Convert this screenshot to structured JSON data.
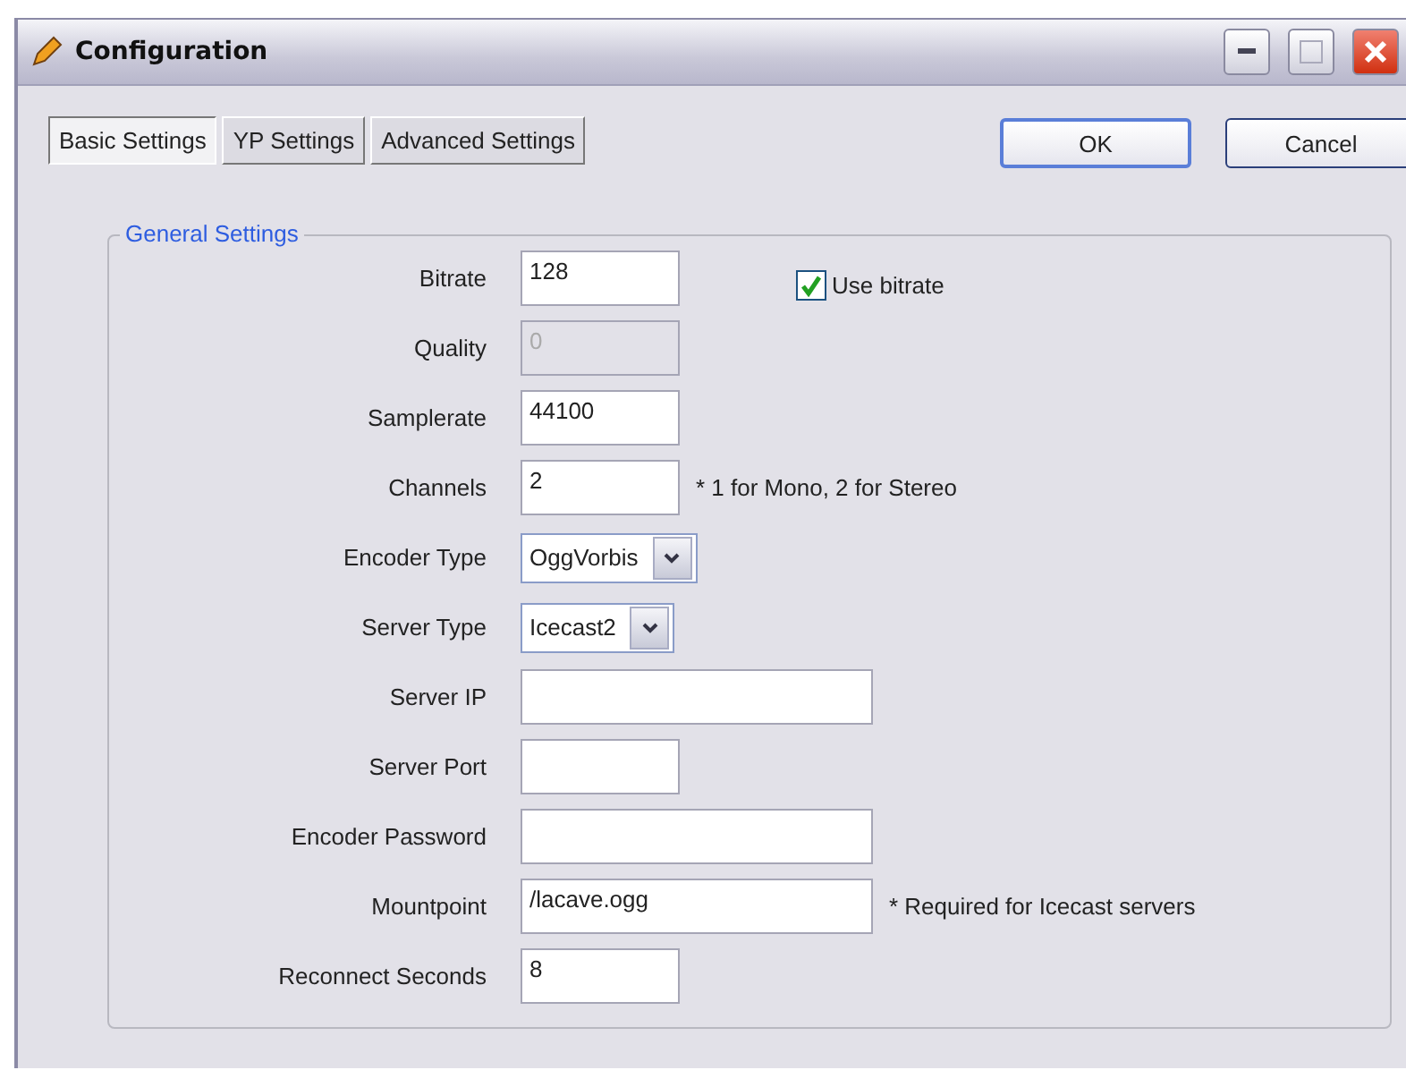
{
  "window": {
    "title": "Configuration"
  },
  "tabs": [
    {
      "label": "Basic Settings",
      "selected": true
    },
    {
      "label": "YP Settings",
      "selected": false
    },
    {
      "label": "Advanced Settings",
      "selected": false
    }
  ],
  "buttons": [
    {
      "label": "OK",
      "default": true
    },
    {
      "label": "Cancel",
      "default": false
    }
  ],
  "group": {
    "title": "General Settings",
    "rows": [
      {
        "label": "Bitrate",
        "kind": "field",
        "value": "128",
        "checkbox": {
          "label": "Use bitrate",
          "checked": true
        }
      },
      {
        "label": "Quality",
        "kind": "field",
        "value": "0",
        "disabled": true
      },
      {
        "label": "Samplerate",
        "kind": "field",
        "value": "44100"
      },
      {
        "label": "Channels",
        "kind": "field",
        "value": "2",
        "note": "* 1 for Mono, 2 for Stereo"
      },
      {
        "label": "Encoder Type",
        "kind": "combo",
        "value": "OggVorbis"
      },
      {
        "label": "Server Type",
        "kind": "combo",
        "value": "Icecast2"
      },
      {
        "label": "Server IP",
        "kind": "widefield",
        "value": ""
      },
      {
        "label": "Server Port",
        "kind": "field",
        "value": ""
      },
      {
        "label": "Encoder Password",
        "kind": "widefield",
        "value": ""
      },
      {
        "label": "Mountpoint",
        "kind": "widefield",
        "value": "/lacave.ogg",
        "note": "* Required for Icecast servers"
      },
      {
        "label": "Reconnect Seconds",
        "kind": "field",
        "value": "8"
      }
    ]
  }
}
